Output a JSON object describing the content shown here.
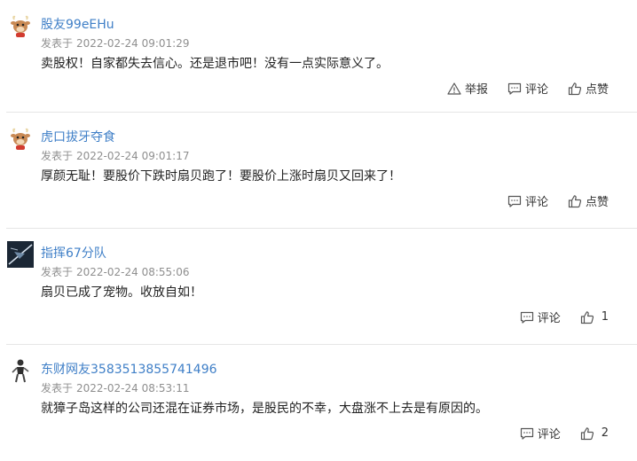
{
  "comments": [
    {
      "username": "股友99eEHu",
      "meta_label": "发表于",
      "timestamp": "2022-02-24 09:01:29",
      "content": "卖股权！自家都失去信心。还是退市吧！没有一点实际意义了。",
      "report_label": "举报",
      "reply_label": "评论",
      "like_label": "点赞",
      "avatar": "ox-cartoon-avatar"
    },
    {
      "username": "虎口拔牙夺食",
      "meta_label": "发表于",
      "timestamp": "2022-02-24 09:01:17",
      "content": "厚颜无耻！要股价下跌时扇贝跑了！要股价上涨时扇贝又回来了！",
      "reply_label": "评论",
      "like_label": "点赞",
      "avatar": "ox-cartoon-avatar"
    },
    {
      "username": "指挥67分队",
      "meta_label": "发表于",
      "timestamp": "2022-02-24 08:55:06",
      "content": "扇贝已成了宠物。收放自如！",
      "reply_label": "评论",
      "like_count": "1",
      "avatar": "dark-photo-avatar"
    },
    {
      "username": "东财网友3583513855741496",
      "meta_label": "发表于",
      "timestamp": "2022-02-24 08:53:11",
      "content": "就獐子岛这样的公司还混在证券市场，是股民的不幸，大盘涨不上去是有原因的。",
      "reply_label": "评论",
      "like_count": "2",
      "avatar": "person-figure-avatar"
    }
  ],
  "colors": {
    "username": "#3f7fc7",
    "meta": "#8f8f8f",
    "divider": "#e6e6e6"
  }
}
